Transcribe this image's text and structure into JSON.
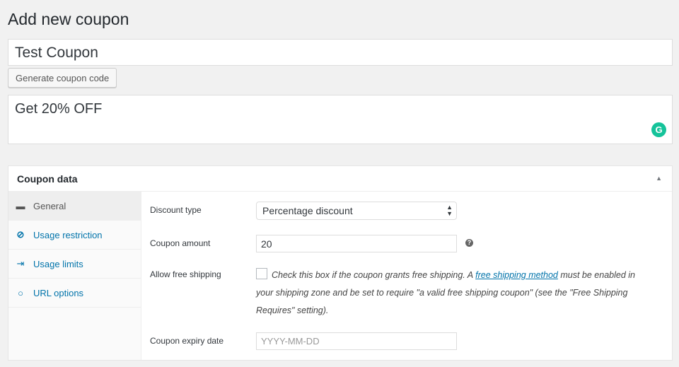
{
  "page": {
    "title": "Add new coupon"
  },
  "coupon": {
    "code": "Test Coupon",
    "generate_label": "Generate coupon code",
    "description": "Get 20% OFF",
    "grammarly_icon": "G"
  },
  "panel": {
    "title": "Coupon data",
    "tabs": [
      {
        "label": "General",
        "icon": "ticket-icon",
        "active": true
      },
      {
        "label": "Usage restriction",
        "icon": "prohibited-icon"
      },
      {
        "label": "Usage limits",
        "icon": "limits-icon"
      },
      {
        "label": "URL options",
        "icon": "gear-icon"
      }
    ],
    "fields": {
      "discount_type_label": "Discount type",
      "discount_type_value": "Percentage discount",
      "amount_label": "Coupon amount",
      "amount_value": "20",
      "free_shipping_label": "Allow free shipping",
      "free_shipping_text_1": "Check this box if the coupon grants free shipping. A ",
      "free_shipping_link": "free shipping method",
      "free_shipping_text_2": " must be enabled in your shipping zone and be set to require \"a valid free shipping coupon\" (see the \"Free Shipping Requires\" setting).",
      "expiry_label": "Coupon expiry date",
      "expiry_placeholder": "YYYY-MM-DD"
    }
  },
  "colors": {
    "link": "#0073aa",
    "grammarly": "#15c39a",
    "background": "#f1f1f1"
  }
}
